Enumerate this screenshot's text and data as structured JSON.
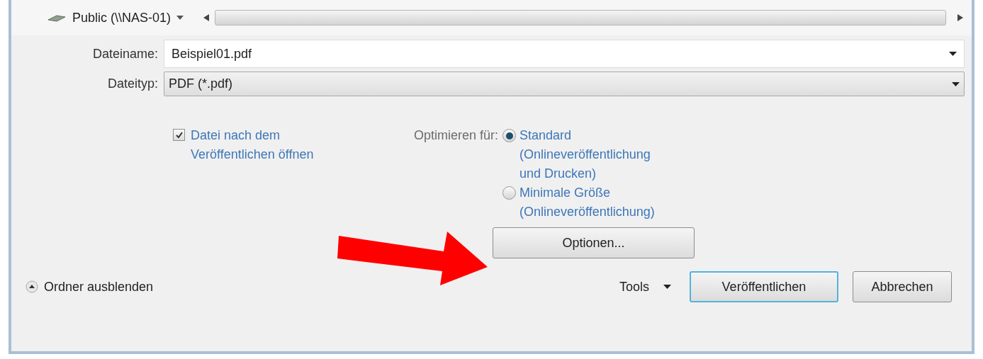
{
  "location": {
    "label": "Public (\\\\NAS-01)"
  },
  "filename": {
    "label": "Dateiname:",
    "value": "Beispiel01.pdf"
  },
  "filetype": {
    "label": "Dateityp:",
    "value": "PDF (*.pdf)"
  },
  "open_after": {
    "label": "Datei nach dem Veröffentlichen öffnen",
    "checked": true
  },
  "optimize": {
    "label": "Optimieren für:",
    "options": [
      {
        "label": "Standard (Onlineveröffentlichung und Drucken)",
        "selected": true
      },
      {
        "label": "Minimale Größe (Onlineveröffentlichung)",
        "selected": false
      }
    ]
  },
  "options_button": "Optionen...",
  "hide_folders": "Ordner ausblenden",
  "tools": "Tools",
  "buttons": [
    {
      "label": "Veröffentlichen",
      "default": true
    },
    {
      "label": "Abbrechen",
      "default": false
    }
  ]
}
